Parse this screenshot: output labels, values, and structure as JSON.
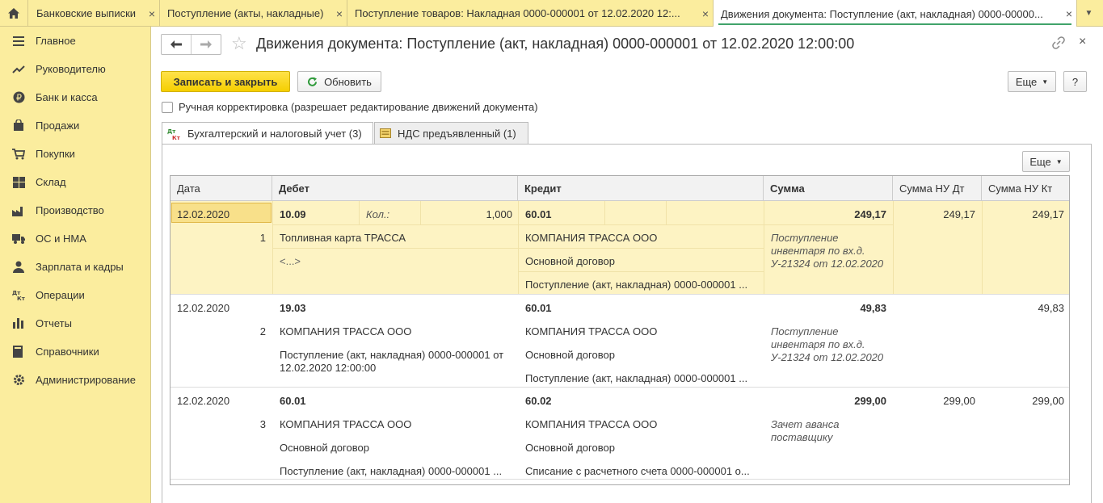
{
  "tabs": [
    {
      "label": "Банковские выписки"
    },
    {
      "label": "Поступление (акты, накладные)"
    },
    {
      "label": "Поступление товаров: Накладная 0000-000001 от 12.02.2020 12:..."
    },
    {
      "label": "Движения документа: Поступление (акт, накладная) 0000-00000..."
    }
  ],
  "sidebar": {
    "items": [
      {
        "label": "Главное",
        "icon": "menu-icon"
      },
      {
        "label": "Руководителю",
        "icon": "trend-icon"
      },
      {
        "label": "Банк и касса",
        "icon": "ruble-icon"
      },
      {
        "label": "Продажи",
        "icon": "bag-icon"
      },
      {
        "label": "Покупки",
        "icon": "cart-icon"
      },
      {
        "label": "Склад",
        "icon": "warehouse-icon"
      },
      {
        "label": "Производство",
        "icon": "factory-icon"
      },
      {
        "label": "ОС и НМА",
        "icon": "truck-icon"
      },
      {
        "label": "Зарплата и кадры",
        "icon": "person-icon"
      },
      {
        "label": "Операции",
        "icon": "dt-kt-icon"
      },
      {
        "label": "Отчеты",
        "icon": "bar-chart-icon"
      },
      {
        "label": "Справочники",
        "icon": "book-icon"
      },
      {
        "label": "Администрирование",
        "icon": "gear-icon"
      }
    ]
  },
  "header": {
    "title": "Движения документа: Поступление (акт, накладная) 0000-000001 от 12.02.2020 12:00:00"
  },
  "toolbar": {
    "save_close": "Записать и закрыть",
    "refresh": "Обновить",
    "more": "Еще",
    "help": "?"
  },
  "manual": {
    "label": "Ручная корректировка (разрешает редактирование движений документа)"
  },
  "form_tabs": [
    {
      "label": "Бухгалтерский и налоговый учет (3)",
      "icon": "dt-kt-icon"
    },
    {
      "label": "НДС предъявленный (1)",
      "icon": "register-icon"
    }
  ],
  "table": {
    "more": "Еще",
    "columns": [
      "Дата",
      "Дебет",
      "Кредит",
      "Сумма",
      "Сумма НУ Дт",
      "Сумма НУ Кт"
    ],
    "rows": [
      {
        "date": "12.02.2020",
        "num": "1",
        "debit_account": "10.09",
        "qty_label": "Кол.:",
        "qty": "1,000",
        "debit_sub1": "Топливная карта ТРАССА",
        "debit_sub2": "<...>",
        "credit_account": "60.01",
        "credit_sub1": "КОМПАНИЯ ТРАССА ООО",
        "credit_sub2": "Основной договор",
        "credit_sub3": "Поступление (акт, накладная) 0000-000001 ...",
        "sum": "249,17",
        "comment": "Поступление инвентаря по вх.д. У-21324 от 12.02.2020",
        "sum_nu_dt": "249,17",
        "sum_nu_kt": "249,17"
      },
      {
        "date": "12.02.2020",
        "num": "2",
        "debit_account": "19.03",
        "debit_sub1": "КОМПАНИЯ ТРАССА ООО",
        "debit_sub2": "Поступление (акт, накладная) 0000-000001 от 12.02.2020 12:00:00",
        "credit_account": "60.01",
        "credit_sub1": "КОМПАНИЯ ТРАССА ООО",
        "credit_sub2": "Основной договор",
        "credit_sub3": "Поступление (акт, накладная) 0000-000001 ...",
        "sum": "49,83",
        "comment": "Поступление инвентаря по вх.д. У-21324 от 12.02.2020",
        "sum_nu_dt": "",
        "sum_nu_kt": "49,83"
      },
      {
        "date": "12.02.2020",
        "num": "3",
        "debit_account": "60.01",
        "debit_sub1": "КОМПАНИЯ ТРАССА ООО",
        "debit_sub2": "Основной договор",
        "debit_sub3": "Поступление (акт, накладная) 0000-000001 ...",
        "credit_account": "60.02",
        "credit_sub1": "КОМПАНИЯ ТРАССА ООО",
        "credit_sub2": "Основной договор",
        "credit_sub3": "Списание с расчетного счета 0000-000001 о...",
        "sum": "299,00",
        "comment": "Зачет аванса поставщику",
        "sum_nu_dt": "299,00",
        "sum_nu_kt": "299,00"
      }
    ]
  },
  "colors": {
    "sidebar_bg": "#fbed9e",
    "selected_row": "#fdf3c3",
    "primary_button": "#f5cf00",
    "accent_green": "#41a36b"
  }
}
